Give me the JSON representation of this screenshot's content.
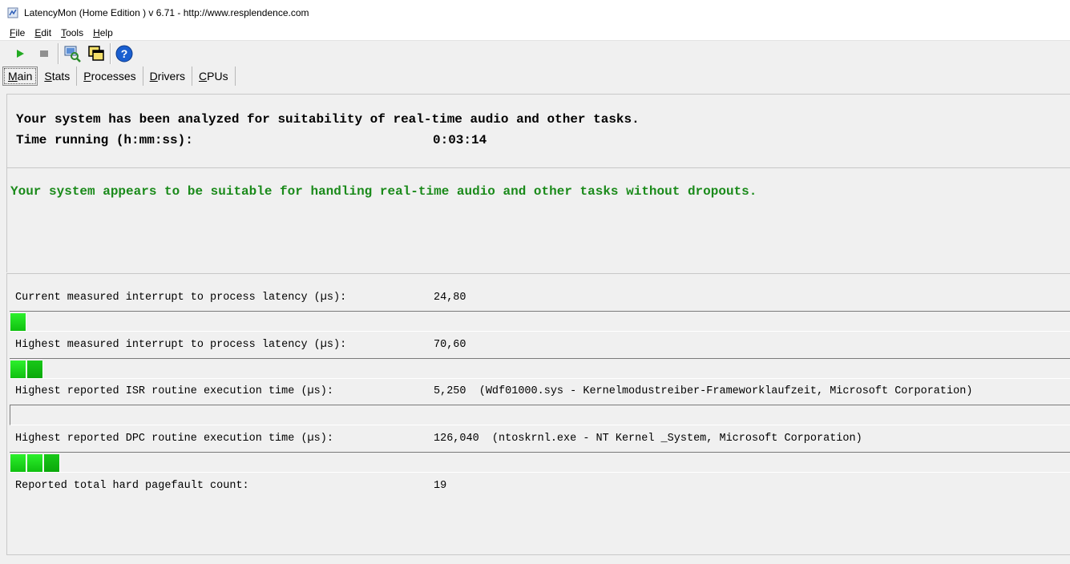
{
  "window": {
    "title": "LatencyMon  (Home Edition )  v 6.71 - http://www.resplendence.com",
    "icon": "latencymon-app-icon"
  },
  "menu": [
    {
      "label": "File",
      "underline": "F",
      "rest": "ile"
    },
    {
      "label": "Edit",
      "underline": "E",
      "rest": "dit"
    },
    {
      "label": "Tools",
      "underline": "T",
      "rest": "ools"
    },
    {
      "label": "Help",
      "underline": "H",
      "rest": "elp"
    }
  ],
  "toolbar": {
    "icons": [
      "play-icon",
      "stop-icon",
      "search-computer-icon",
      "windows-icon",
      "help-icon"
    ],
    "colors": {
      "play": "#22aa22",
      "stop": "#909090",
      "help": "#1a5fd0"
    }
  },
  "tabs": [
    {
      "label": "Main",
      "underline": "M",
      "rest": "ain",
      "active": true
    },
    {
      "label": "Stats",
      "underline": "S",
      "rest": "tats",
      "active": false
    },
    {
      "label": "Processes",
      "underline": "P",
      "rest": "rocesses",
      "active": false
    },
    {
      "label": "Drivers",
      "underline": "D",
      "rest": "rivers",
      "active": false
    },
    {
      "label": "CPUs",
      "underline": "C",
      "rest": "PUs",
      "active": false
    }
  ],
  "summary": {
    "analyzed_text": "Your system has been analyzed for suitability of real-time audio and other tasks.",
    "time_running_label": "Time running (h:mm:ss):",
    "time_running_value": "0:03:14"
  },
  "verdict": {
    "text": "Your system appears to be suitable for handling real-time audio and other tasks without dropouts.",
    "color": "#1a8a1a"
  },
  "metrics": [
    {
      "label": "Current measured interrupt to process latency (µs):",
      "value": "24,80",
      "detail": "",
      "bar_segments": 1
    },
    {
      "label": "Highest measured interrupt to process latency (µs):",
      "value": "70,60",
      "detail": "",
      "bar_segments": 2
    },
    {
      "label": "Highest reported ISR routine execution time (µs):",
      "value": "5,250",
      "detail": "(Wdf01000.sys - Kernelmodustreiber-Frameworklaufzeit, Microsoft Corporation)",
      "bar_segments": 0
    },
    {
      "label": "Highest reported DPC routine execution time (µs):",
      "value": "126,040",
      "detail": "(ntoskrnl.exe - NT Kernel _System, Microsoft Corporation)",
      "bar_segments": 3
    },
    {
      "label": "Reported total hard pagefault count:",
      "value": "19",
      "detail": ""
    }
  ],
  "bar_color": "#1ee01e"
}
